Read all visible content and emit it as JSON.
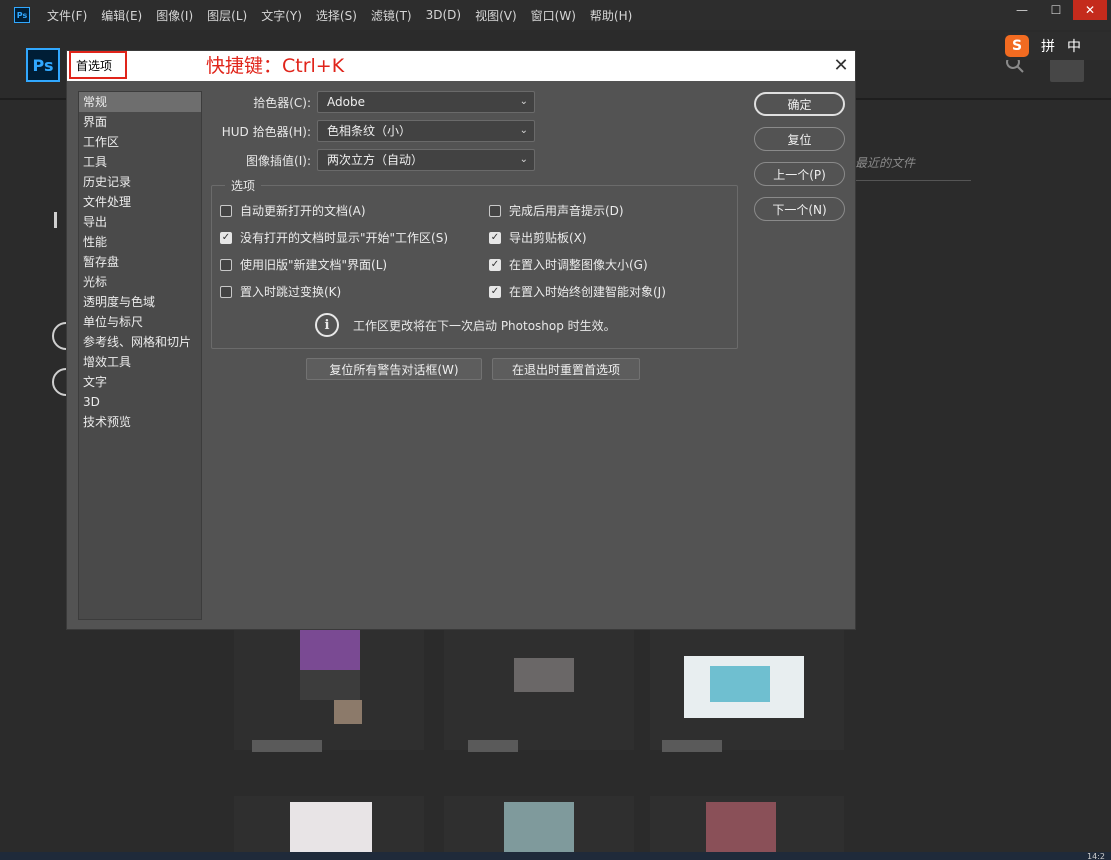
{
  "menubar": {
    "app_icon": "Ps",
    "items": [
      "文件(F)",
      "编辑(E)",
      "图像(I)",
      "图层(L)",
      "文字(Y)",
      "选择(S)",
      "滤镜(T)",
      "3D(D)",
      "视图(V)",
      "窗口(W)",
      "帮助(H)"
    ]
  },
  "window_controls": {
    "minimize": "—",
    "maximize": "☐",
    "close": "✕"
  },
  "home": {
    "logo": "Ps",
    "recent_label": "最近的文件"
  },
  "ime": {
    "logo": "S",
    "mode": "拼",
    "lang": "中"
  },
  "dialog": {
    "title": "首选项",
    "shortcut_note": "快捷键：Ctrl+K",
    "close_glyph": "✕",
    "categories": [
      "常规",
      "界面",
      "工作区",
      "工具",
      "历史记录",
      "文件处理",
      "导出",
      "性能",
      "暂存盘",
      "光标",
      "透明度与色域",
      "单位与标尺",
      "参考线、网格和切片",
      "增效工具",
      "文字",
      "3D",
      "技术预览"
    ],
    "fields": {
      "color_picker_label": "拾色器(C):",
      "color_picker_value": "Adobe",
      "hud_picker_label": "HUD 拾色器(H):",
      "hud_picker_value": "色相条纹（小）",
      "interp_label": "图像插值(I):",
      "interp_value": "两次立方（自动）"
    },
    "options_title": "选项",
    "options": {
      "o1": "自动更新打开的文档(A)",
      "o2": "没有打开的文档时显示\"开始\"工作区(S)",
      "o3": "使用旧版\"新建文档\"界面(L)",
      "o4": "置入时跳过变换(K)",
      "o5": "完成后用声音提示(D)",
      "o6": "导出剪贴板(X)",
      "o7": "在置入时调整图像大小(G)",
      "o8": "在置入时始终创建智能对象(J)"
    },
    "info_text": "工作区更改将在下一次启动 Photoshop 时生效。",
    "buttons": {
      "ok": "确定",
      "reset": "复位",
      "prev": "上一个(P)",
      "next": "下一个(N)",
      "reset_warnings": "复位所有警告对话框(W)",
      "reset_on_quit": "在退出时重置首选项"
    }
  },
  "clock": "14:2"
}
